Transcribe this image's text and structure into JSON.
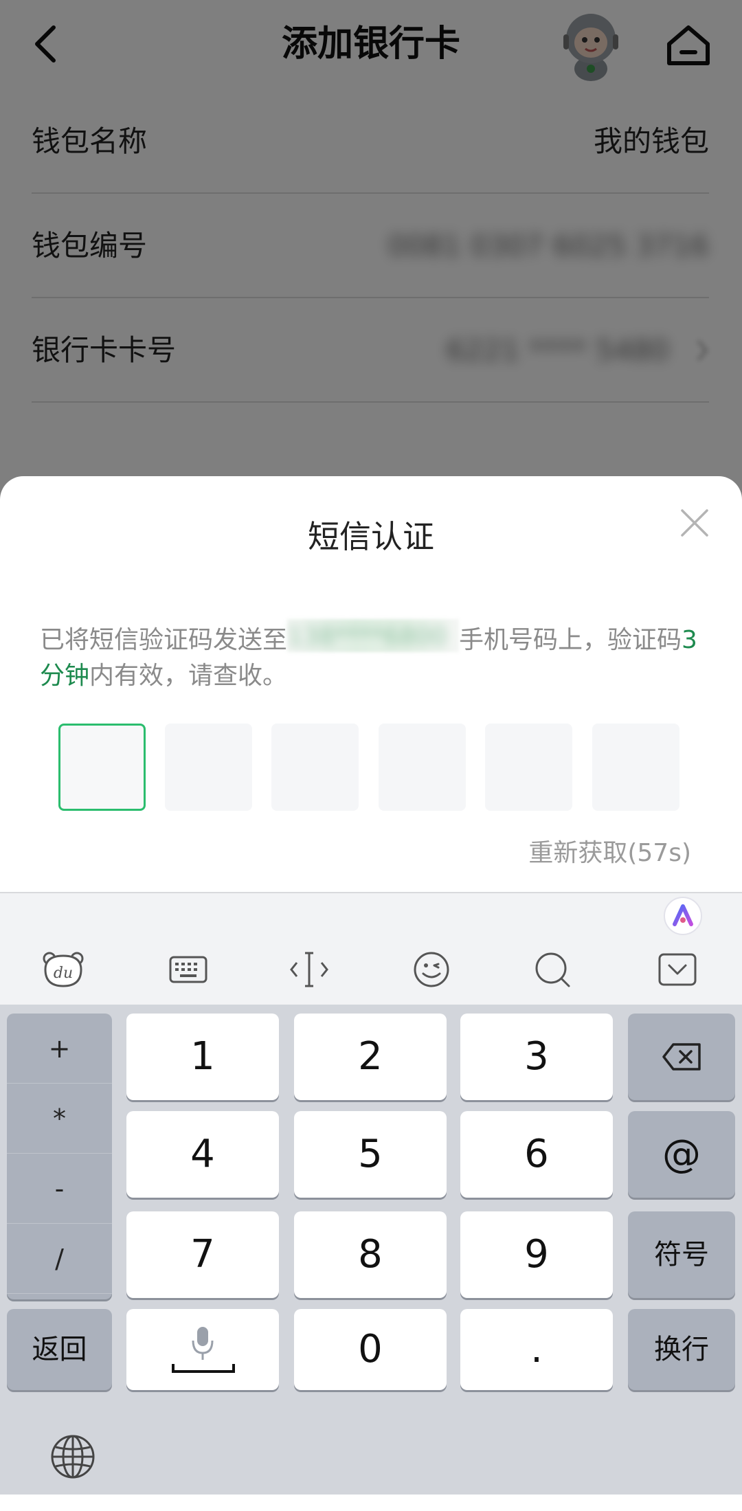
{
  "header": {
    "title": "添加银行卡",
    "back_icon": "chevron-left-icon",
    "mascot_icon": "robot-mascot-icon",
    "home_icon": "home-icon"
  },
  "wallet_info": {
    "rows": [
      {
        "label": "钱包名称",
        "value": "我的钱包"
      },
      {
        "label": "钱包编号",
        "value": "0081 0307 6025 3716"
      },
      {
        "label": "银行卡卡号",
        "value": "6221 **** 5480"
      }
    ]
  },
  "sms_dialog": {
    "title": "短信认证",
    "close_icon": "close-icon",
    "message_prefix": "已将短信验证码发送至",
    "message_phone": "138****6800",
    "message_middle": "手机号码上，验证码",
    "message_highlight": "3分钟",
    "message_suffix": "内有效，请查收。",
    "code_digits": [
      "",
      "",
      "",
      "",
      "",
      ""
    ],
    "resend_label": "重新获取(57s)",
    "accent_color": "#2bbd6e",
    "highlight_color": "#1d8a4e"
  },
  "keyboard": {
    "toolbar_icons": [
      "du-bear-icon",
      "keyboard-icon",
      "cursor-move-icon",
      "emoji-icon",
      "search-icon",
      "collapse-keyboard-icon"
    ],
    "ai_icon": "ai-assistant-icon",
    "symbol_keys": [
      "+",
      "*",
      "-",
      "/"
    ],
    "digit_rows": [
      [
        "1",
        "2",
        "3"
      ],
      [
        "4",
        "5",
        "6"
      ],
      [
        "7",
        "8",
        "9"
      ]
    ],
    "zero": "0",
    "dot": ".",
    "backspace_icon": "backspace-icon",
    "at_key": "@",
    "symbols_key": "符号",
    "back_key": "返回",
    "enter_key": "换行",
    "mic_icon": "microphone-icon",
    "globe_icon": "globe-icon"
  }
}
